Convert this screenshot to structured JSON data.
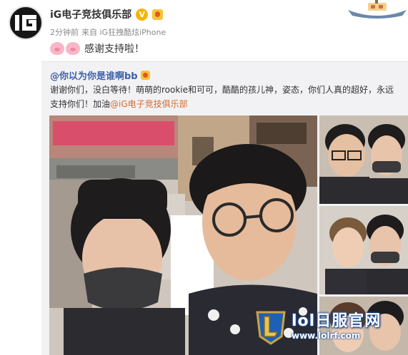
{
  "poster": {
    "name": "iG电子竞技俱乐部",
    "verified_badge": "V",
    "time": "2分钟前",
    "source": "来自 iG狂拽酷炫iPhone",
    "text": "感谢支持啦！",
    "emoji": "pig-face-emoji"
  },
  "repost": {
    "user": "@你以为你是谁啊bb",
    "text_before": "谢谢你们，没白等待！萌萌的rookie和可可，酷酷的孩儿神，姿态，你们人真的超好，永远支持你们！加油",
    "mention": "@iG电子竞技俱乐部"
  },
  "photos": {
    "main": "selfie-photo",
    "thumbnails": [
      "thumbnail-photo-1",
      "thumbnail-photo-2",
      "thumbnail-photo-3"
    ]
  },
  "watermark": {
    "title": "lol日服官网",
    "url": "www.lolrf.com"
  },
  "colors": {
    "link": "#3d5fa8",
    "mention": "#d36a2b",
    "card_bg": "#f2f2f5",
    "verified": "#f6b400"
  }
}
